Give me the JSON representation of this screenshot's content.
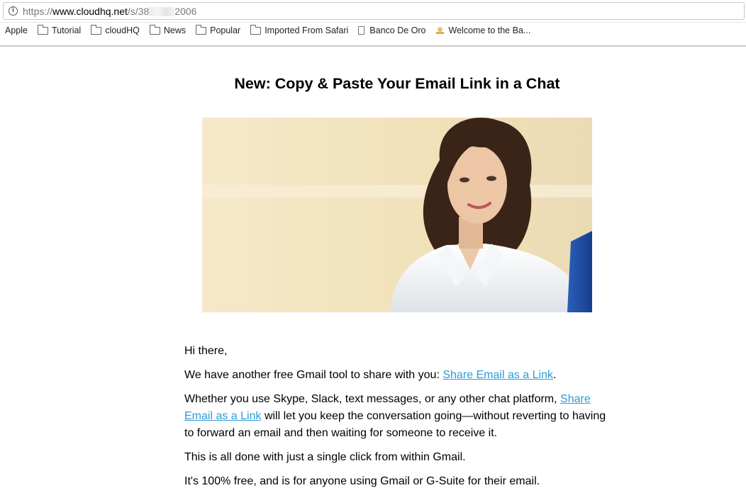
{
  "browser": {
    "url_protocol": "https://",
    "url_host": "www.cloudhq.net",
    "url_path_start": "/s/38",
    "url_path_end": "2006",
    "info_icon": "info-icon",
    "bookmarks": [
      {
        "label": "Apple",
        "icon": "none"
      },
      {
        "label": "Tutorial",
        "icon": "folder-icon"
      },
      {
        "label": "cloudHQ",
        "icon": "folder-icon"
      },
      {
        "label": "News",
        "icon": "folder-icon"
      },
      {
        "label": "Popular",
        "icon": "folder-icon"
      },
      {
        "label": "Imported From Safari",
        "icon": "folder-icon"
      },
      {
        "label": "Banco De Oro",
        "icon": "page-icon"
      },
      {
        "label": "Welcome to the Ba...",
        "icon": "bank-icon"
      }
    ]
  },
  "email": {
    "headline": "New: Copy & Paste Your Email Link in a Chat",
    "hero_image": "woman-smiling-at-laptop",
    "greeting": "Hi there,",
    "p1_before": "We have another free Gmail tool to share with you: ",
    "p1_link": "Share Email as a Link",
    "p1_after": ".",
    "p2_before": "Whether you use Skype, Slack, text messages, or any other chat platform, ",
    "p2_link": "Share Email as a Link",
    "p2_after": " will let you keep the conversation going—without reverting to having to forward an email and then waiting for someone to receive it.",
    "p3": "This is all done with just a single click from within Gmail.",
    "p4": "It's 100% free, and is for anyone using Gmail or G-Suite for their email.",
    "link_color": "#2d9bd9"
  }
}
